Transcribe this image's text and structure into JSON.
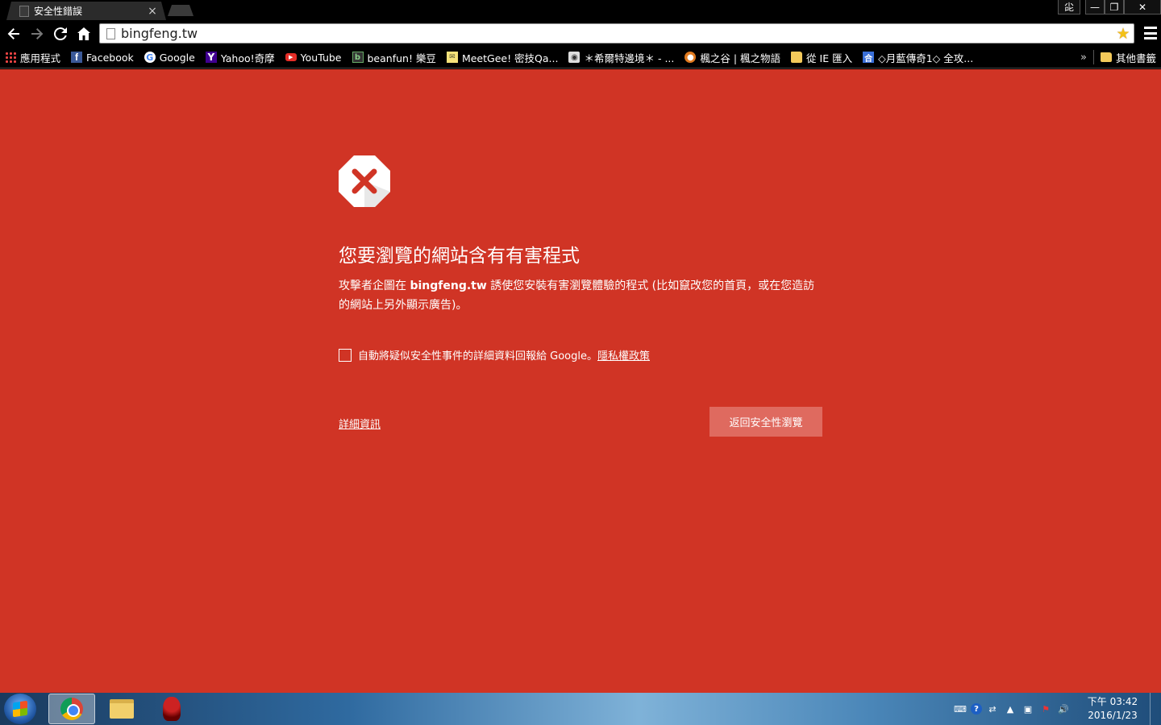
{
  "tab": {
    "title": "安全性錯誤",
    "close": "×"
  },
  "window_controls": {
    "ime": "㕾",
    "minimize": "—",
    "maximize": "❐",
    "close": "✕"
  },
  "address_bar": {
    "url": "bingfeng.tw"
  },
  "bookmarks": [
    {
      "label": "應用程式",
      "icon": "apps-icon"
    },
    {
      "label": "Facebook",
      "icon": "facebook-icon",
      "glyph": "f"
    },
    {
      "label": "Google",
      "icon": "google-icon",
      "glyph": "G"
    },
    {
      "label": "Yahoo!奇摩",
      "icon": "yahoo-icon",
      "glyph": "Y"
    },
    {
      "label": "YouTube",
      "icon": "youtube-icon",
      "glyph": "▶"
    },
    {
      "label": "beanfun! 樂豆",
      "icon": "beanfun-icon",
      "glyph": "b"
    },
    {
      "label": "MeetGee! 密技Qa...",
      "icon": "mail-icon",
      "glyph": "✉"
    },
    {
      "label": "＊希爾特邊境＊ - ...",
      "icon": "owl-icon",
      "glyph": "◉"
    },
    {
      "label": "楓之谷 | 楓之物語",
      "icon": "maplestory-icon",
      "glyph": "●"
    },
    {
      "label": "從 IE 匯入",
      "icon": "folder-icon",
      "glyph": ""
    },
    {
      "label": "◇月藍傳奇1◇ 全攻...",
      "icon": "blue-bookmark-icon",
      "glyph": "合"
    }
  ],
  "bookmarks_overflow": "»",
  "other_bookmarks": "其他書籤",
  "interstitial": {
    "heading": "您要瀏覽的網站含有有害程式",
    "explain_prefix": "攻擊者企圖在 ",
    "explain_domain": "bingfeng.tw",
    "explain_suffix": " 誘使您安裝有害瀏覽體驗的程式 (比如竄改您的首頁，或在您造訪的網站上另外顯示廣告)。",
    "report_text": "自動將疑似安全性事件的詳細資料回報給 Google。",
    "privacy_link": "隱私權政策",
    "details_link": "詳細資訊",
    "back_button": "返回安全性瀏覽"
  },
  "taskbar": {
    "clock_period_time": "下午 03:42",
    "clock_date": "2016/1/23"
  },
  "colors": {
    "danger_background": "#d03425",
    "primary_button": "#df6a5f"
  }
}
